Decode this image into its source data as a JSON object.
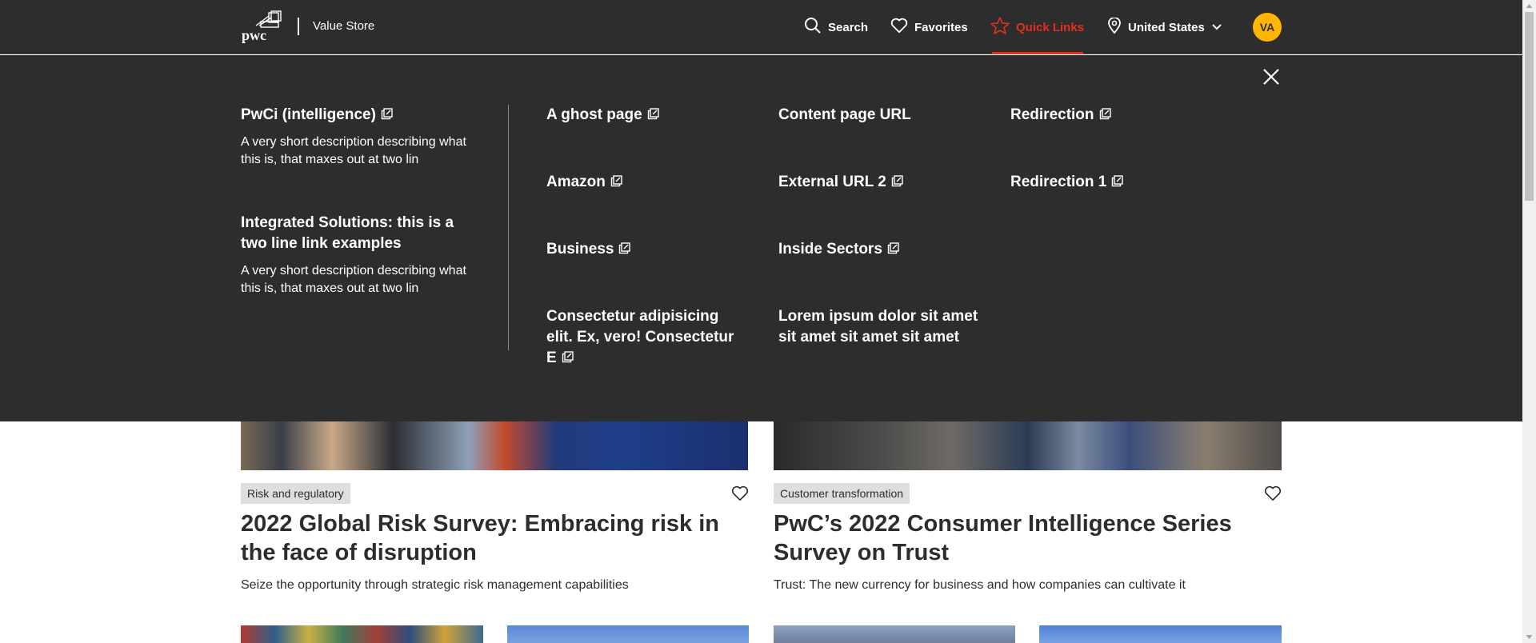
{
  "header": {
    "logo_text": "pwc",
    "store_name": "Value Store",
    "nav": {
      "search": "Search",
      "favorites": "Favorites",
      "quick_links": "Quick Links",
      "country": "United States"
    },
    "avatar_initials": "VA"
  },
  "quick_links": {
    "featured": [
      {
        "title": "PwCi (intelligence)",
        "description": "A very short description describing what this is, that maxes out at two lin"
      },
      {
        "title": "Integrated Solutions: this is a two line link examples",
        "description": "A very short description describing what this is, that maxes out at two lin"
      }
    ],
    "links": [
      "A ghost page",
      "Amazon",
      "Business",
      "Consectetur adipisicing elit. Ex, vero! Consectetur E",
      "Content page URL",
      "External URL 2",
      "Inside Sectors",
      "Lorem ipsum dolor sit amet sit amet sit amet sit amet",
      "Redirection",
      "Redirection 1"
    ]
  },
  "cards": [
    {
      "tag": "Risk and regulatory",
      "title": "2022 Global Risk Survey: Embracing risk in the face of disruption",
      "description": "Seize the opportunity through strategic risk management capabilities"
    },
    {
      "tag": "Customer transformation",
      "title": "PwC’s 2022 Consumer Intelligence Series Survey on Trust",
      "description": "Trust: The new currency for business and how companies can cultivate it"
    }
  ],
  "colors": {
    "header_bg": "#2d2d2d",
    "accent": "#e0301e",
    "avatar_bg": "#ffb600",
    "tag_bg": "#dedede"
  },
  "icons": [
    "pwc-logo",
    "search-icon",
    "heart-icon",
    "star-icon",
    "location-pin-icon",
    "chevron-down-icon",
    "close-icon",
    "external-link-icon"
  ]
}
